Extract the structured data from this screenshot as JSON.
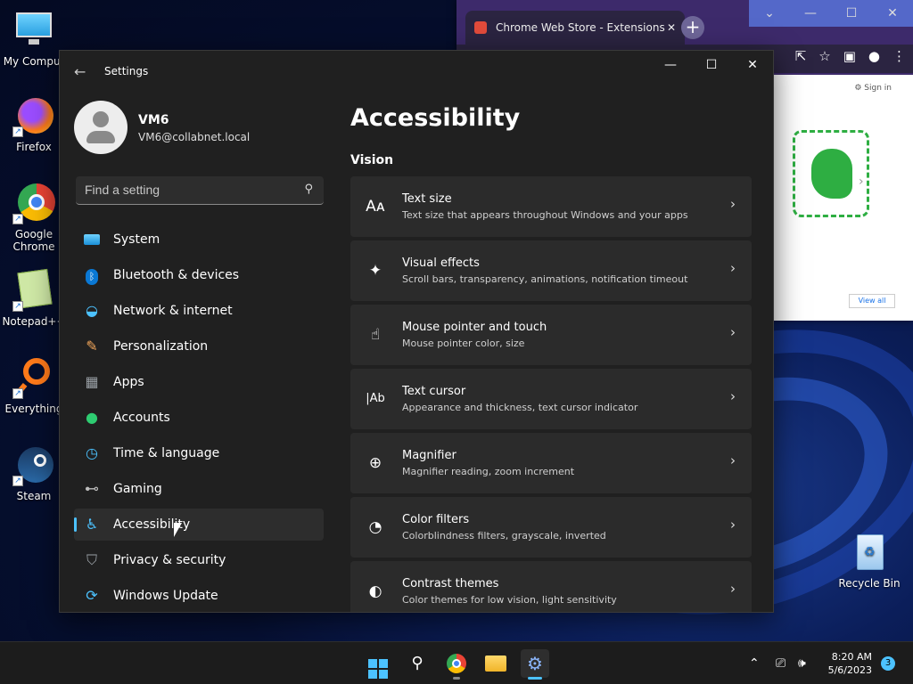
{
  "desktop": {
    "icons": [
      {
        "label": "My Comput"
      },
      {
        "label": "Firefox"
      },
      {
        "label": "Google Chrome"
      },
      {
        "label": "Notepad++"
      },
      {
        "label": "Everything"
      },
      {
        "label": "Steam"
      },
      {
        "label": "Recycle Bin"
      }
    ]
  },
  "chrome": {
    "tab_title": "Chrome Web Store - Extensions",
    "sign_in": "Sign in",
    "view_all": "View all"
  },
  "settings": {
    "window_title": "Settings",
    "profile": {
      "name": "VM6",
      "email": "VM6@collabnet.local"
    },
    "search_placeholder": "Find a setting",
    "nav": [
      {
        "label": "System",
        "icon": "system-icon",
        "color": "#4cc2ff"
      },
      {
        "label": "Bluetooth & devices",
        "icon": "bluetooth-icon",
        "color": "#0078d4"
      },
      {
        "label": "Network & internet",
        "icon": "wifi-icon",
        "color": "#4cc2ff"
      },
      {
        "label": "Personalization",
        "icon": "paintbrush-icon",
        "color": "#f2a65a"
      },
      {
        "label": "Apps",
        "icon": "apps-icon",
        "color": "#9aa0a6"
      },
      {
        "label": "Accounts",
        "icon": "person-icon",
        "color": "#2ecc71"
      },
      {
        "label": "Time & language",
        "icon": "clock-globe-icon",
        "color": "#4cc2ff"
      },
      {
        "label": "Gaming",
        "icon": "gamepad-icon",
        "color": "#bdbdbd"
      },
      {
        "label": "Accessibility",
        "icon": "accessibility-icon",
        "color": "#4cc2ff"
      },
      {
        "label": "Privacy & security",
        "icon": "shield-icon",
        "color": "#9aa0a6"
      },
      {
        "label": "Windows Update",
        "icon": "update-icon",
        "color": "#4cc2ff"
      }
    ],
    "active_nav": "Accessibility",
    "page_title": "Accessibility",
    "section": "Vision",
    "cards": [
      {
        "title": "Text size",
        "subtitle": "Text size that appears throughout Windows and your apps",
        "icon": "text-size-icon",
        "glyph": "Aᴀ"
      },
      {
        "title": "Visual effects",
        "subtitle": "Scroll bars, transparency, animations, notification timeout",
        "icon": "sparkle-icon",
        "glyph": "✦"
      },
      {
        "title": "Mouse pointer and touch",
        "subtitle": "Mouse pointer color, size",
        "icon": "pointer-touch-icon",
        "glyph": "☝"
      },
      {
        "title": "Text cursor",
        "subtitle": "Appearance and thickness, text cursor indicator",
        "icon": "text-cursor-icon",
        "glyph": "|Ab"
      },
      {
        "title": "Magnifier",
        "subtitle": "Magnifier reading, zoom increment",
        "icon": "magnifier-icon",
        "glyph": "⊕"
      },
      {
        "title": "Color filters",
        "subtitle": "Colorblindness filters, grayscale, inverted",
        "icon": "palette-icon",
        "glyph": "◔"
      },
      {
        "title": "Contrast themes",
        "subtitle": "Color themes for low vision, light sensitivity",
        "icon": "contrast-icon",
        "glyph": "◐"
      }
    ]
  },
  "taskbar": {
    "time": "8:20 AM",
    "date": "5/6/2023",
    "notification_count": "3"
  }
}
